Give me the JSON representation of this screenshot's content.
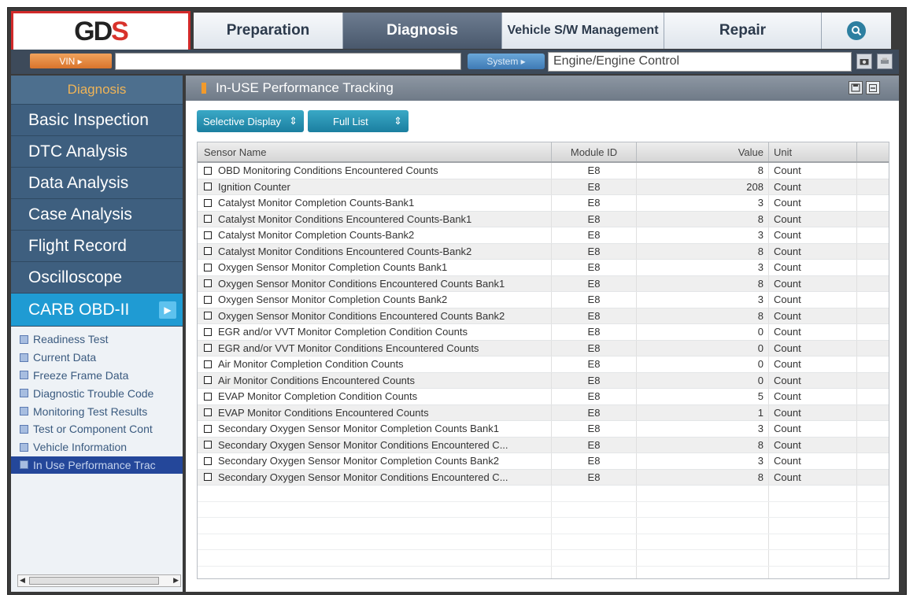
{
  "brand": {
    "logo_left": "GD",
    "logo_right": "S"
  },
  "topnav": {
    "tabs": [
      {
        "label": "Preparation",
        "active": false
      },
      {
        "label": "Diagnosis",
        "active": true
      },
      {
        "label": "Vehicle S/W Management",
        "active": false
      },
      {
        "label": "Repair",
        "active": false
      }
    ]
  },
  "toolbar": {
    "vin_label": "VIN ▸",
    "vin_value": "",
    "system_label": "System ▸",
    "system_value": "Engine/Engine Control"
  },
  "sidebar": {
    "header": "Diagnosis",
    "items": [
      {
        "label": "Basic Inspection"
      },
      {
        "label": "DTC Analysis"
      },
      {
        "label": "Data Analysis"
      },
      {
        "label": "Case Analysis"
      },
      {
        "label": "Flight Record"
      },
      {
        "label": "Oscilloscope"
      }
    ],
    "active_item": {
      "label": "CARB OBD-II",
      "arrow": "▶"
    },
    "subitems": [
      {
        "label": "Readiness Test"
      },
      {
        "label": "Current Data"
      },
      {
        "label": "Freeze Frame Data"
      },
      {
        "label": "Diagnostic Trouble Code"
      },
      {
        "label": "Monitoring Test Results"
      },
      {
        "label": "Test or Component Cont"
      },
      {
        "label": "Vehicle Information"
      },
      {
        "label": "In Use Performance Trac"
      }
    ]
  },
  "panel": {
    "title": "In-USE Performance Tracking",
    "filter_display": "Selective Display",
    "filter_list": "Full List",
    "columns": {
      "name": "Sensor Name",
      "module": "Module ID",
      "value": "Value",
      "unit": "Unit"
    },
    "rows": [
      {
        "name": "OBD Monitoring Conditions Encountered Counts",
        "module": "E8",
        "value": "8",
        "unit": "Count"
      },
      {
        "name": "Ignition Counter",
        "module": "E8",
        "value": "208",
        "unit": "Count"
      },
      {
        "name": "Catalyst Monitor Completion Counts-Bank1",
        "module": "E8",
        "value": "3",
        "unit": "Count"
      },
      {
        "name": "Catalyst Monitor Conditions Encountered Counts-Bank1",
        "module": "E8",
        "value": "8",
        "unit": "Count"
      },
      {
        "name": "Catalyst Monitor Completion Counts-Bank2",
        "module": "E8",
        "value": "3",
        "unit": "Count"
      },
      {
        "name": "Catalyst Monitor Conditions Encountered Counts-Bank2",
        "module": "E8",
        "value": "8",
        "unit": "Count"
      },
      {
        "name": "Oxygen Sensor Monitor Completion Counts Bank1",
        "module": "E8",
        "value": "3",
        "unit": "Count"
      },
      {
        "name": "Oxygen Sensor Monitor Conditions Encountered Counts Bank1",
        "module": "E8",
        "value": "8",
        "unit": "Count"
      },
      {
        "name": "Oxygen Sensor Monitor Completion Counts Bank2",
        "module": "E8",
        "value": "3",
        "unit": "Count"
      },
      {
        "name": "Oxygen Sensor Monitor Conditions Encountered Counts Bank2",
        "module": "E8",
        "value": "8",
        "unit": "Count"
      },
      {
        "name": "EGR and/or VVT Monitor Completion Condition Counts",
        "module": "E8",
        "value": "0",
        "unit": "Count"
      },
      {
        "name": "EGR and/or VVT Monitor Conditions Encountered Counts",
        "module": "E8",
        "value": "0",
        "unit": "Count"
      },
      {
        "name": "Air Monitor Completion Condition Counts",
        "module": "E8",
        "value": "0",
        "unit": "Count"
      },
      {
        "name": "Air Monitor Conditions Encountered Counts",
        "module": "E8",
        "value": "0",
        "unit": "Count"
      },
      {
        "name": "EVAP Monitor Completion Condition Counts",
        "module": "E8",
        "value": "5",
        "unit": "Count"
      },
      {
        "name": "EVAP Monitor Conditions Encountered Counts",
        "module": "E8",
        "value": "1",
        "unit": "Count"
      },
      {
        "name": "Secondary Oxygen Sensor Monitor Completion Counts Bank1",
        "module": "E8",
        "value": "3",
        "unit": "Count"
      },
      {
        "name": "Secondary Oxygen Sensor Monitor Conditions Encountered C...",
        "module": "E8",
        "value": "8",
        "unit": "Count"
      },
      {
        "name": "Secondary Oxygen Sensor Monitor Completion Counts Bank2",
        "module": "E8",
        "value": "3",
        "unit": "Count"
      },
      {
        "name": "Secondary Oxygen Sensor Monitor Conditions Encountered C...",
        "module": "E8",
        "value": "8",
        "unit": "Count"
      }
    ]
  },
  "colors": {
    "accent_orange": "#f29a2b",
    "logo_border_red": "#d22a2a",
    "sidebar_blue": "#3e5f7f",
    "active_blue": "#1f9bd3",
    "tab_active": "#5a687c"
  },
  "icons": {
    "search": "search-icon",
    "capture": "camera-icon",
    "print": "print-icon",
    "panel_save": "save-icon",
    "panel_minimize": "minimize-icon",
    "subitem": "document-icon"
  }
}
